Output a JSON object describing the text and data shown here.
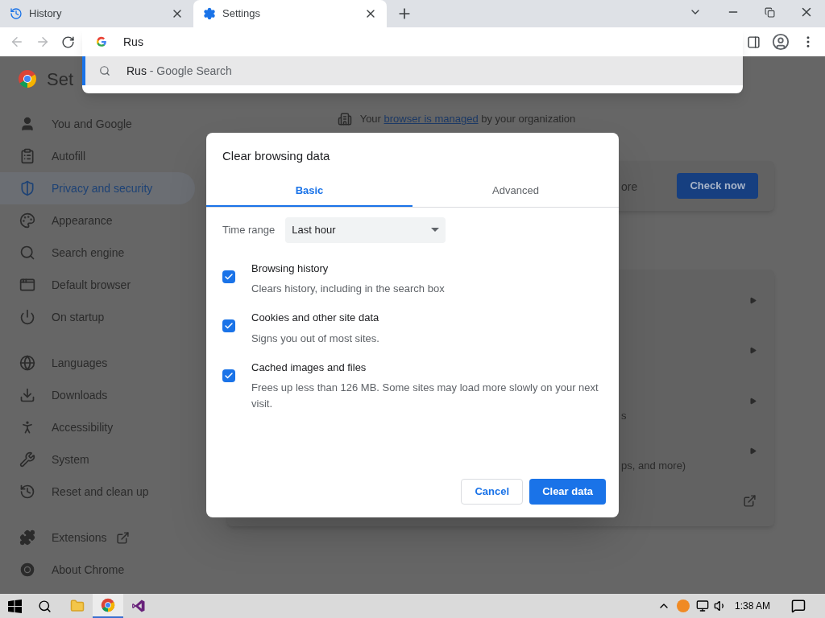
{
  "browser_tabs": [
    {
      "kind": "history",
      "title": "History",
      "selected": false
    },
    {
      "kind": "settings",
      "title": "Settings",
      "selected": true
    }
  ],
  "omnibox": {
    "value": "Rus",
    "suggestions": [
      {
        "text": "Rus",
        "suffix": "- Google Search",
        "selected": true
      }
    ]
  },
  "page_title": "Set",
  "sidebar": {
    "groups": [
      {
        "items": [
          {
            "kind": "person",
            "label": "You and Google",
            "selected": false
          },
          {
            "kind": "clipboard",
            "label": "Autofill",
            "selected": false
          },
          {
            "kind": "shield",
            "label": "Privacy and security",
            "selected": true
          },
          {
            "kind": "palette",
            "label": "Appearance",
            "selected": false
          },
          {
            "kind": "search",
            "label": "Search engine",
            "selected": false
          },
          {
            "kind": "window",
            "label": "Default browser",
            "selected": false
          },
          {
            "kind": "power",
            "label": "On startup",
            "selected": false
          }
        ]
      },
      {
        "items": [
          {
            "kind": "globe",
            "label": "Languages",
            "selected": false
          },
          {
            "kind": "download",
            "label": "Downloads",
            "selected": false
          },
          {
            "kind": "accessibility",
            "label": "Accessibility",
            "selected": false
          },
          {
            "kind": "wrench",
            "label": "System",
            "selected": false
          },
          {
            "kind": "history",
            "label": "Reset and clean up",
            "selected": false
          }
        ]
      },
      {
        "items": [
          {
            "kind": "puzzle",
            "label": "Extensions",
            "selected": false,
            "external": true
          },
          {
            "kind": "chrome",
            "label": "About Chrome",
            "selected": false
          }
        ]
      }
    ]
  },
  "managed_notice": {
    "before": "Your",
    "link": "browser is managed",
    "after": "by your organization"
  },
  "safety_card": {
    "text": "ore",
    "button": "Check now"
  },
  "privacy_rows": [
    {
      "kind": "arrow"
    },
    {
      "kind": "arrow"
    },
    {
      "kind": "arrow",
      "text": "s"
    },
    {
      "kind": "arrow",
      "text": "ps, and more)"
    },
    {
      "kind": "external"
    }
  ],
  "dialog": {
    "title": "Clear browsing data",
    "tabs": [
      {
        "label": "Basic",
        "selected": true
      },
      {
        "label": "Advanced",
        "selected": false
      }
    ],
    "time_range": {
      "label": "Time range",
      "value": "Last hour"
    },
    "items": [
      {
        "title": "Browsing history",
        "description": "Clears history, including in the search box",
        "checked": true
      },
      {
        "title": "Cookies and other site data",
        "description": "Signs you out of most sites.",
        "checked": true
      },
      {
        "title": "Cached images and files",
        "description": "Frees up less than 126 MB. Some sites may load more slowly on your next visit.",
        "checked": true
      }
    ],
    "cancel": "Cancel",
    "confirm": "Clear data"
  },
  "taskbar": {
    "apps": [
      {
        "kind": "explorer",
        "active": false
      },
      {
        "kind": "chrome",
        "active": true
      },
      {
        "kind": "studio",
        "active": false
      }
    ],
    "clock": "1:38 AM"
  }
}
